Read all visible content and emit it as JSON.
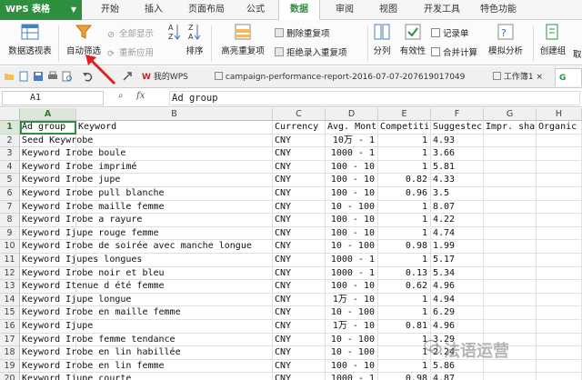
{
  "app": {
    "name": "WPS 表格"
  },
  "menu_tabs": [
    "开始",
    "插入",
    "页面布局",
    "公式",
    "数据",
    "审阅",
    "视图",
    "开发工具",
    "特色功能"
  ],
  "active_menu_tab": "数据",
  "ribbon": {
    "pivot_table": "数据透视表",
    "auto_filter": "自动筛选",
    "show_all": "全部显示",
    "reapply": "重新应用",
    "sort": "排序",
    "highlight_duplicates": "高亮重复项",
    "delete_duplicates": "删除重复项",
    "reject_duplicates": "拒绝录入重复项",
    "split": "分列",
    "validity": "有效性",
    "record_form": "记录单",
    "consolidate": "合并计算",
    "whatif": "模拟分析",
    "create_group": "创建组",
    "more": "取"
  },
  "doc_tabs": {
    "mywps": "我的WPS",
    "file": "campaign-performance-report-2016-07-07-207619017049",
    "workbook": "工作簿1"
  },
  "formula_bar": {
    "name_box": "A1",
    "fx": "fx",
    "content": "Ad group"
  },
  "columns": [
    "A",
    "B",
    "C",
    "D",
    "E",
    "F",
    "G",
    "H"
  ],
  "rows": [
    [
      "1",
      "Ad group",
      "Keyword",
      "Currency",
      "Avg. Mont",
      "Competiti",
      "Suggestec",
      "Impr. sha",
      "Organic"
    ],
    [
      "2",
      "Seed Keywrobe",
      "",
      "CNY",
      "10万 - 1",
      "1",
      "4.93",
      "",
      ""
    ],
    [
      "3",
      "Keyword Irobe boule",
      "",
      "CNY",
      "1000 - 1",
      "1",
      "3.66",
      "",
      ""
    ],
    [
      "4",
      "Keyword Irobe imprimé",
      "",
      "CNY",
      "100 - 10",
      "1",
      "5.81",
      "",
      ""
    ],
    [
      "5",
      "Keyword Irobe jupe",
      "",
      "CNY",
      "100 - 10",
      "0.82",
      "4.33",
      "",
      ""
    ],
    [
      "6",
      "Keyword Irobe pull blanche",
      "",
      "CNY",
      "100 - 10",
      "0.96",
      "3.5",
      "",
      ""
    ],
    [
      "7",
      "Keyword Irobe maille femme",
      "",
      "CNY",
      "10 - 100",
      "1",
      "8.07",
      "",
      ""
    ],
    [
      "8",
      "Keyword Irobe a rayure",
      "",
      "CNY",
      "100 - 10",
      "1",
      "4.22",
      "",
      ""
    ],
    [
      "9",
      "Keyword Ijupe rouge femme",
      "",
      "CNY",
      "100 - 10",
      "1",
      "4.74",
      "",
      ""
    ],
    [
      "10",
      "Keyword Irobe de soirée avec manche longue",
      "",
      "CNY",
      "10 - 100",
      "0.98",
      "1.99",
      "",
      ""
    ],
    [
      "11",
      "Keyword Ijupes longues",
      "",
      "CNY",
      "1000 - 1",
      "1",
      "5.17",
      "",
      ""
    ],
    [
      "12",
      "Keyword Irobe noir et bleu",
      "",
      "CNY",
      "1000 - 1",
      "0.13",
      "5.34",
      "",
      ""
    ],
    [
      "13",
      "Keyword Itenue d été femme",
      "",
      "CNY",
      "100 - 10",
      "0.62",
      "4.96",
      "",
      ""
    ],
    [
      "14",
      "Keyword Ijupe longue",
      "",
      "CNY",
      "1万 - 10",
      "1",
      "4.94",
      "",
      ""
    ],
    [
      "15",
      "Keyword Irobe en maille femme",
      "",
      "CNY",
      "10 - 100",
      "1",
      "6.29",
      "",
      ""
    ],
    [
      "16",
      "Keyword Ijupe",
      "",
      "CNY",
      "1万 - 10",
      "0.81",
      "4.96",
      "",
      ""
    ],
    [
      "17",
      "Keyword Irobe femme tendance",
      "",
      "CNY",
      "10 - 100",
      "1",
      "3.29",
      "",
      ""
    ],
    [
      "18",
      "Keyword Irobe en lin habillée",
      "",
      "CNY",
      "10 - 100",
      "1",
      "2.24",
      "",
      ""
    ],
    [
      "19",
      "Keyword Irobe en lin femme",
      "",
      "CNY",
      "100 - 10",
      "1",
      "5.86",
      "",
      ""
    ],
    [
      "20",
      "Keyword Ijupe courte",
      "",
      "CNY",
      "1000 - 1",
      "0.98",
      "4.87",
      "",
      ""
    ]
  ],
  "watermark": "法语运营",
  "colors": {
    "accent": "#2e8f3e",
    "arrow": "#e02020"
  }
}
